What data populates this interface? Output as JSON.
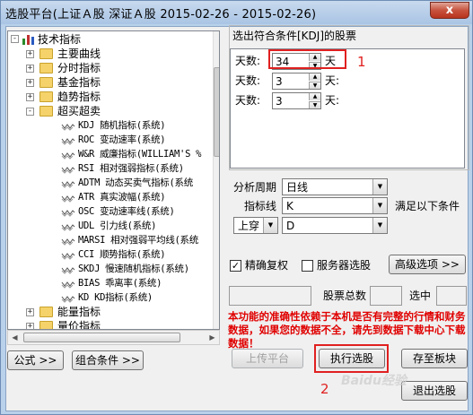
{
  "window": {
    "title": "选股平台(上证Ａ股 深证Ａ股   2015-02-26 - 2015-02-26)",
    "close": "x"
  },
  "tree": {
    "root": "技术指标",
    "items": [
      {
        "label": "主要曲线",
        "expand": "+"
      },
      {
        "label": "分时指标",
        "expand": "+"
      },
      {
        "label": "基金指标",
        "expand": "+"
      },
      {
        "label": "趋势指标",
        "expand": "+"
      },
      {
        "label": "超买超卖",
        "expand": "-"
      },
      {
        "label": "KDJ 随机指标(系统)"
      },
      {
        "label": "ROC 变动速率(系统)"
      },
      {
        "label": "W&R 威廉指标(WILLIAM'S %"
      },
      {
        "label": "RSI 相对强弱指标(系统)"
      },
      {
        "label": "ADTM 动态买卖气指标(系统"
      },
      {
        "label": "ATR 真实波幅(系统)"
      },
      {
        "label": "OSC 变动速率线(系统)"
      },
      {
        "label": "UDL 引力线(系统)"
      },
      {
        "label": "MARSI 相对强弱平均线(系统"
      },
      {
        "label": "CCI 顺势指标(系统)"
      },
      {
        "label": "SKDJ 慢速随机指标(系统)"
      },
      {
        "label": "BIAS 乖离率(系统)"
      },
      {
        "label": "KD KD指标(系统)"
      },
      {
        "label": "能量指标",
        "expand": "+"
      },
      {
        "label": "量价指标",
        "expand": "+"
      }
    ]
  },
  "cond": {
    "title": "选出符合条件[KDJ]的股票",
    "rows": [
      {
        "label": "天数:",
        "value": "34",
        "unit": "天"
      },
      {
        "label": "天数:",
        "value": "3",
        "unit": "天:"
      },
      {
        "label": "天数:",
        "value": "3",
        "unit": "天:"
      }
    ]
  },
  "period": {
    "label": "分析周期",
    "value": "日线"
  },
  "indline": {
    "label": "指标线",
    "value": "K",
    "suffix": "满足以下条件"
  },
  "cross": {
    "value": "上穿",
    "value2": "D"
  },
  "options": {
    "exact_label": "精确复权",
    "server_label": "服务器选股",
    "advanced": "高级选项 >>"
  },
  "stats": {
    "count_label": "股票总数",
    "selected_label": "选中"
  },
  "warning": "本功能的准确性依赖于本机是否有完整的行情和财务数据，如果您的数据不全，请先到数据下载中心下载数据！",
  "buttons": {
    "formula": "公式 >>",
    "combo": "组合条件 >>",
    "upload": "上传平台",
    "execute": "执行选股",
    "save": "存至板块",
    "exit": "退出选股"
  },
  "annotations": {
    "one": "1",
    "two": "2"
  },
  "watermark": "Baidu经验"
}
